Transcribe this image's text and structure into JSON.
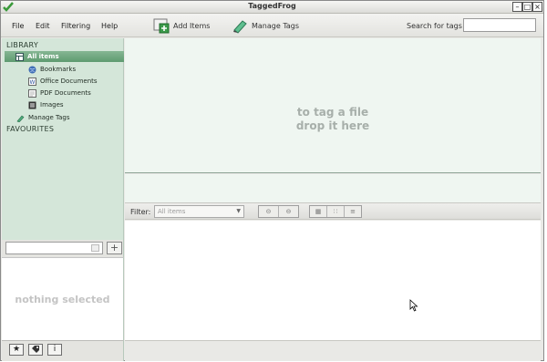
{
  "window": {
    "title": "TaggedFrog"
  },
  "menu": {
    "file": "File",
    "edit": "Edit",
    "filtering": "Filtering",
    "help": "Help"
  },
  "toolbar": {
    "add_items": "Add Items",
    "manage_tags": "Manage Tags",
    "search_label": "Search for tags",
    "search_value": ""
  },
  "sidebar": {
    "library_heading": "LIBRARY",
    "all_items": "All items",
    "bookmarks": "Bookmarks",
    "office_documents": "Office Documents",
    "pdf_documents": "PDF Documents",
    "images": "Images",
    "manage_tags": "Manage Tags",
    "favourites_heading": "FAVOURITES",
    "tag_filter_value": ""
  },
  "details": {
    "empty_text": "nothing selected"
  },
  "dropzone": {
    "line1": "to tag a file",
    "line2": "drop it here"
  },
  "filterbar": {
    "label": "Filter:",
    "selected": "All items"
  },
  "bottom_bar": {
    "info_label": "i"
  },
  "colors": {
    "sidebar_bg": "#d4e6d9",
    "selected_bg": "#5e9b70",
    "dropzone_bg": "#eff6f1"
  }
}
